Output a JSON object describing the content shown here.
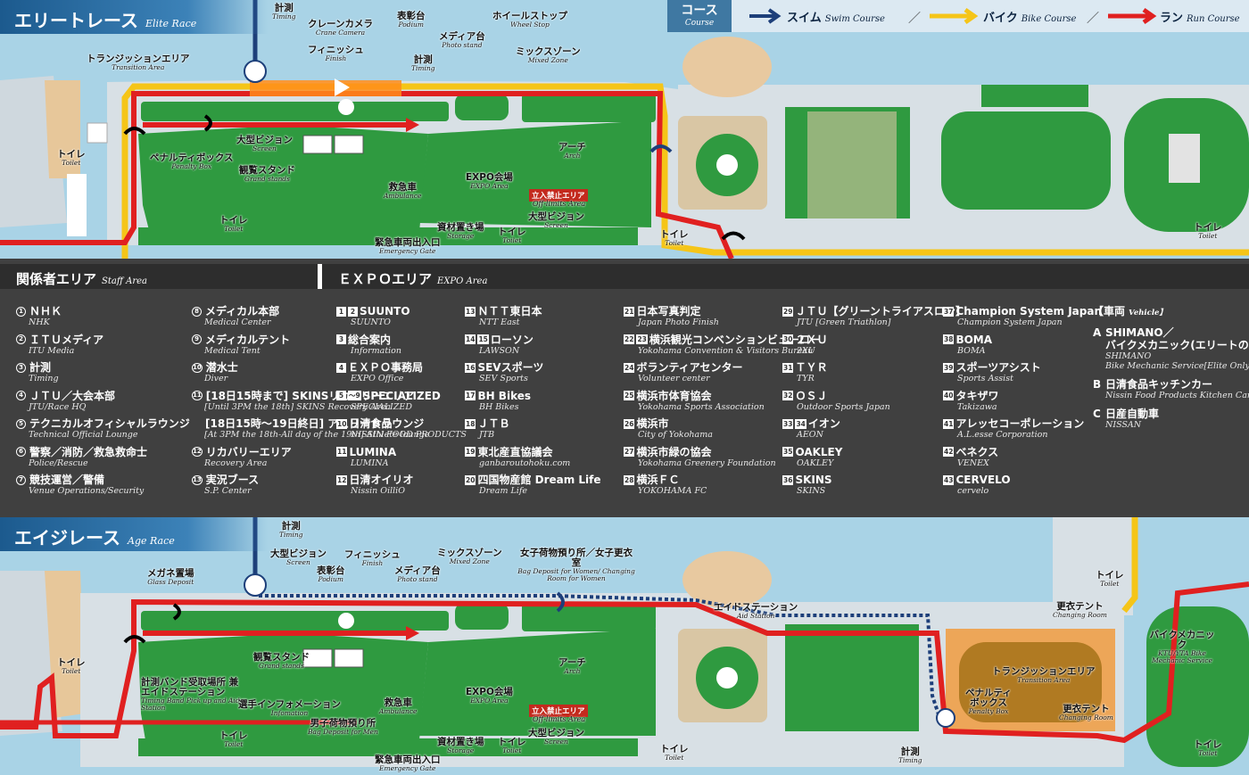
{
  "elite": {
    "title": "エリートレース",
    "title_en": "Elite Race",
    "labels": {
      "timing": [
        "計測",
        "Timing"
      ],
      "crane": [
        "クレーンカメラ",
        "Crane Camera"
      ],
      "podium": [
        "表彰台",
        "Podium"
      ],
      "wheel": [
        "ホイールストップ",
        "Wheel Stop"
      ],
      "transition": [
        "トランジッションエリア",
        "Transition Area"
      ],
      "finish": [
        "フィニッシュ",
        "Finish"
      ],
      "media": [
        "メディア台",
        "Photo stand"
      ],
      "timing2": [
        "計測",
        "Timing"
      ],
      "mixed": [
        "ミックスゾーン",
        "Mixed Zone"
      ],
      "screen": [
        "大型ビジョン",
        "Screen"
      ],
      "penalty": [
        "ペナルティボックス",
        "Penalty Box"
      ],
      "grandstand": [
        "観覧スタンド",
        "Grand stands"
      ],
      "ambulance": [
        "救急車",
        "Ambulance"
      ],
      "expo": [
        "EXPO会場",
        "EXPO Area"
      ],
      "arch": [
        "アーチ",
        "Arch"
      ],
      "toilet1": [
        "トイレ",
        "Toilet"
      ],
      "toilet2": [
        "トイレ",
        "Toilet"
      ],
      "toilet3": [
        "トイレ",
        "Toilet"
      ],
      "toilet4": [
        "トイレ",
        "Toilet"
      ],
      "toilet5": [
        "トイレ",
        "Toilet"
      ],
      "storage": [
        "資材置き場",
        "Storage"
      ],
      "screen2": [
        "大型ビジョン",
        "Screen"
      ],
      "emergency": [
        "緊急車両出入口",
        "Emergency Gate"
      ],
      "offlimits_en": "Off-limits Area"
    },
    "offlimits": "立入禁止エリア"
  },
  "legend": {
    "course": "コース",
    "course_en": "Course",
    "swim": "スイム",
    "swim_en": "Swim Course",
    "bike": "バイク",
    "bike_en": "Bike Course",
    "run": "ラン",
    "run_en": "Run Course",
    "sep": "／",
    "colors": {
      "swim": "#1d3f7a",
      "bike": "#f5c518",
      "run": "#e02020"
    }
  },
  "staff": {
    "title": "関係者エリア",
    "title_en": "Staff Area",
    "col1": [
      {
        "m": "1",
        "t": "ＮＨＫ",
        "s": "NHK"
      },
      {
        "m": "2",
        "t": "ＩＴＵメディア",
        "s": "ITU Media"
      },
      {
        "m": "3",
        "t": "計測",
        "s": "Timing"
      },
      {
        "m": "4",
        "t": "ＪＴＵ／大会本部",
        "s": "JTU/Race HQ"
      },
      {
        "m": "5",
        "t": "テクニカルオフィシャルラウンジ",
        "s": "Technical Official Lounge"
      },
      {
        "m": "6",
        "t": "警察／消防／救急救命士",
        "s": "Police/Rescue"
      },
      {
        "m": "7",
        "t": "競技運営／警備",
        "s": "Venue Operations/Security"
      }
    ],
    "col2": [
      {
        "m": "8",
        "t": "メディカル本部",
        "s": "Medical Center"
      },
      {
        "m": "9",
        "t": "メディカルテント",
        "s": "Medical Tent"
      },
      {
        "m": "10",
        "t": "潜水士",
        "s": "Diver"
      },
      {
        "m": "11",
        "t": "[18日15時まで] SKINSリカバリーエリア",
        "s": "[Until 3PM the 18th] SKINS Recovery Area"
      },
      {
        "m": "",
        "t": "[18日15時～19日終日] アスリートラウンジ",
        "s": "[At 3PM the 18th-All day of the 19th] Athlete lounge"
      },
      {
        "m": "12",
        "t": "リカバリーエリア",
        "s": "Recovery Area"
      },
      {
        "m": "13",
        "t": "実況ブース",
        "s": "S.P. Center"
      }
    ]
  },
  "expo": {
    "title": "ＥＸＰＯエリア",
    "title_en": "EXPO Area",
    "cols": [
      [
        {
          "m": [
            "1",
            "2"
          ],
          "t": "SUUNTO",
          "s": "SUUNTO"
        },
        {
          "m": [
            "3"
          ],
          "t": "総合案内",
          "s": "Information"
        },
        {
          "m": [
            "4"
          ],
          "t": "ＥＸＰＯ事務局",
          "s": "EXPO Office"
        },
        {
          "m": [
            "5",
            "～9"
          ],
          "t": "SPECIALIZED",
          "s": "SPECIALIZED"
        },
        {
          "m": [
            "10"
          ],
          "t": "日清食品",
          "s": "NISSIN FOOD PRODUCTS"
        },
        {
          "m": [
            "11"
          ],
          "t": "LUMINA",
          "s": "LUMINA"
        },
        {
          "m": [
            "12"
          ],
          "t": "日清オイリオ",
          "s": "Nissin OilliO"
        }
      ],
      [
        {
          "m": [
            "13"
          ],
          "t": "ＮＴＴ東日本",
          "s": "NTT East"
        },
        {
          "m": [
            "14",
            "15"
          ],
          "t": "ローソン",
          "s": "LAWSON"
        },
        {
          "m": [
            "16"
          ],
          "t": "SEVスポーツ",
          "s": "SEV Sports"
        },
        {
          "m": [
            "17"
          ],
          "t": "BH Bikes",
          "s": "BH Bikes"
        },
        {
          "m": [
            "18"
          ],
          "t": "ＪＴＢ",
          "s": "JTB"
        },
        {
          "m": [
            "19"
          ],
          "t": "東北産直協議会",
          "s": "ganbaroutohoku.com"
        },
        {
          "m": [
            "20"
          ],
          "t": "四国物産館 Dream Life",
          "s": "Dream Life"
        }
      ],
      [
        {
          "m": [
            "21"
          ],
          "t": "日本写真判定",
          "s": "Japan Photo Finish"
        },
        {
          "m": [
            "22",
            "23"
          ],
          "t": "横浜観光コンベンションビューロー",
          "s": "Yokohama Convention & Visitors Bureau"
        },
        {
          "m": [
            "24"
          ],
          "t": "ボランティアセンター",
          "s": "Volunteer center"
        },
        {
          "m": [
            "25"
          ],
          "t": "横浜市体育協会",
          "s": "Yokohama Sports Association"
        },
        {
          "m": [
            "26"
          ],
          "t": "横浜市",
          "s": "City of Yokohama"
        },
        {
          "m": [
            "27"
          ],
          "t": "横浜市緑の協会",
          "s": "Yokohama Greenery Foundation"
        },
        {
          "m": [
            "28"
          ],
          "t": "横浜ＦＣ",
          "s": "YOKOHAMA FC"
        }
      ],
      [
        {
          "m": [
            "29"
          ],
          "t": "ＪＴＵ【グリーントライアスロン】",
          "s": "JTU [Green Triathlon]"
        },
        {
          "m": [
            "30"
          ],
          "t": "２ＸＵ",
          "s": "2XU"
        },
        {
          "m": [
            "31"
          ],
          "t": "ＴＹＲ",
          "s": "TYR"
        },
        {
          "m": [
            "32"
          ],
          "t": "ＯＳＪ",
          "s": "Outdoor Sports Japan"
        },
        {
          "m": [
            "33",
            "34"
          ],
          "t": "イオン",
          "s": "AEON"
        },
        {
          "m": [
            "35"
          ],
          "t": "OAKLEY",
          "s": "OAKLEY"
        },
        {
          "m": [
            "36"
          ],
          "t": "SKINS",
          "s": "SKINS"
        }
      ],
      [
        {
          "m": [
            "37"
          ],
          "t": "Champion System Japan",
          "s": "Champion System Japan"
        },
        {
          "m": [
            "38"
          ],
          "t": "BOMA",
          "s": "BOMA"
        },
        {
          "m": [
            "39"
          ],
          "t": "スポーツアシスト",
          "s": "Sports Assist"
        },
        {
          "m": [
            "40"
          ],
          "t": "タキザワ",
          "s": "Takizawa"
        },
        {
          "m": [
            "41"
          ],
          "t": "アレッセコーポレーション",
          "s": "A.L.esse Corporation"
        },
        {
          "m": [
            "42"
          ],
          "t": "ベネクス",
          "s": "VENEX"
        },
        {
          "m": [
            "43"
          ],
          "t": "CERVELO",
          "s": "cervelo"
        }
      ]
    ]
  },
  "vehicle": {
    "title": "【車両",
    "title_en": "Vehicle】",
    "items": [
      {
        "m": "A",
        "t": "SHIMANO／",
        "t2": "バイクメカニック(エリートのみ)",
        "s": "SHIMANO",
        "s2": "Bike Mechanic Service[Elite Only]"
      },
      {
        "m": "B",
        "t": "日清食品キッチンカー",
        "s": "Nissin Food Products Kitchen Car"
      },
      {
        "m": "C",
        "t": "日産自動車",
        "s": "NISSAN"
      }
    ]
  },
  "age": {
    "title": "エイジレース",
    "title_en": "Age Race",
    "labels": {
      "timing": [
        "計測",
        "Timing"
      ],
      "screen": [
        "大型ビジョン",
        "Screen"
      ],
      "glass": [
        "メガネ置場",
        "Glass Deposit"
      ],
      "podium": [
        "表彰台",
        "Podium"
      ],
      "finish": [
        "フィニッシュ",
        "Finish"
      ],
      "media": [
        "メディア台",
        "Photo stand"
      ],
      "mixed": [
        "ミックスゾーン",
        "Mixed Zone"
      ],
      "bagw": [
        "女子荷物預り所／女子更衣室",
        "Bag Deposit for Women/ Changing Room for Women"
      ],
      "aid": [
        "エイドステーション",
        "Aid Station"
      ],
      "toilet1": [
        "トイレ",
        "Toilet"
      ],
      "changing1": [
        "更衣テント",
        "Changing Room"
      ],
      "bikemech": [
        "バイクメカニック",
        "KTU/YTA Bike Mechanic Service"
      ],
      "toilet_l": [
        "トイレ",
        "Toilet"
      ],
      "grandstand": [
        "観覧スタンド",
        "Grand stands"
      ],
      "timingband": [
        "計測バンド受取場所 兼 エイドステーション",
        "Timing Band Pick up and Aid Station"
      ],
      "info": [
        "選手インフォメーション",
        "Infomation"
      ],
      "ambulance": [
        "救急車",
        "Ambulance"
      ],
      "bagm": [
        "男子荷物預り所",
        "Bag Deposit for Men"
      ],
      "expo": [
        "EXPO会場",
        "EXPO Area"
      ],
      "arch": [
        "アーチ",
        "Arch"
      ],
      "offlimits_en": "Off-limits Area",
      "transition": [
        "トランジッションエリア",
        "Transition Area"
      ],
      "penalty": [
        "ペナルティ ボックス",
        "Penalty Box"
      ],
      "changing2": [
        "更衣テント",
        "Changing Room"
      ],
      "toilet2": [
        "トイレ",
        "Toilet"
      ],
      "storage": [
        "資材置き場",
        "Storage"
      ],
      "toilet3": [
        "トイレ",
        "Toilet"
      ],
      "screen2": [
        "大型ビジョン",
        "Screen"
      ],
      "toilet4": [
        "トイレ",
        "Toilet"
      ],
      "toilet5": [
        "トイレ",
        "Toilet"
      ],
      "emergency": [
        "緊急車両出入口",
        "Emergency Gate"
      ],
      "timing2": [
        "計測",
        "Timing"
      ]
    },
    "offlimits": "立入禁止エリア"
  }
}
